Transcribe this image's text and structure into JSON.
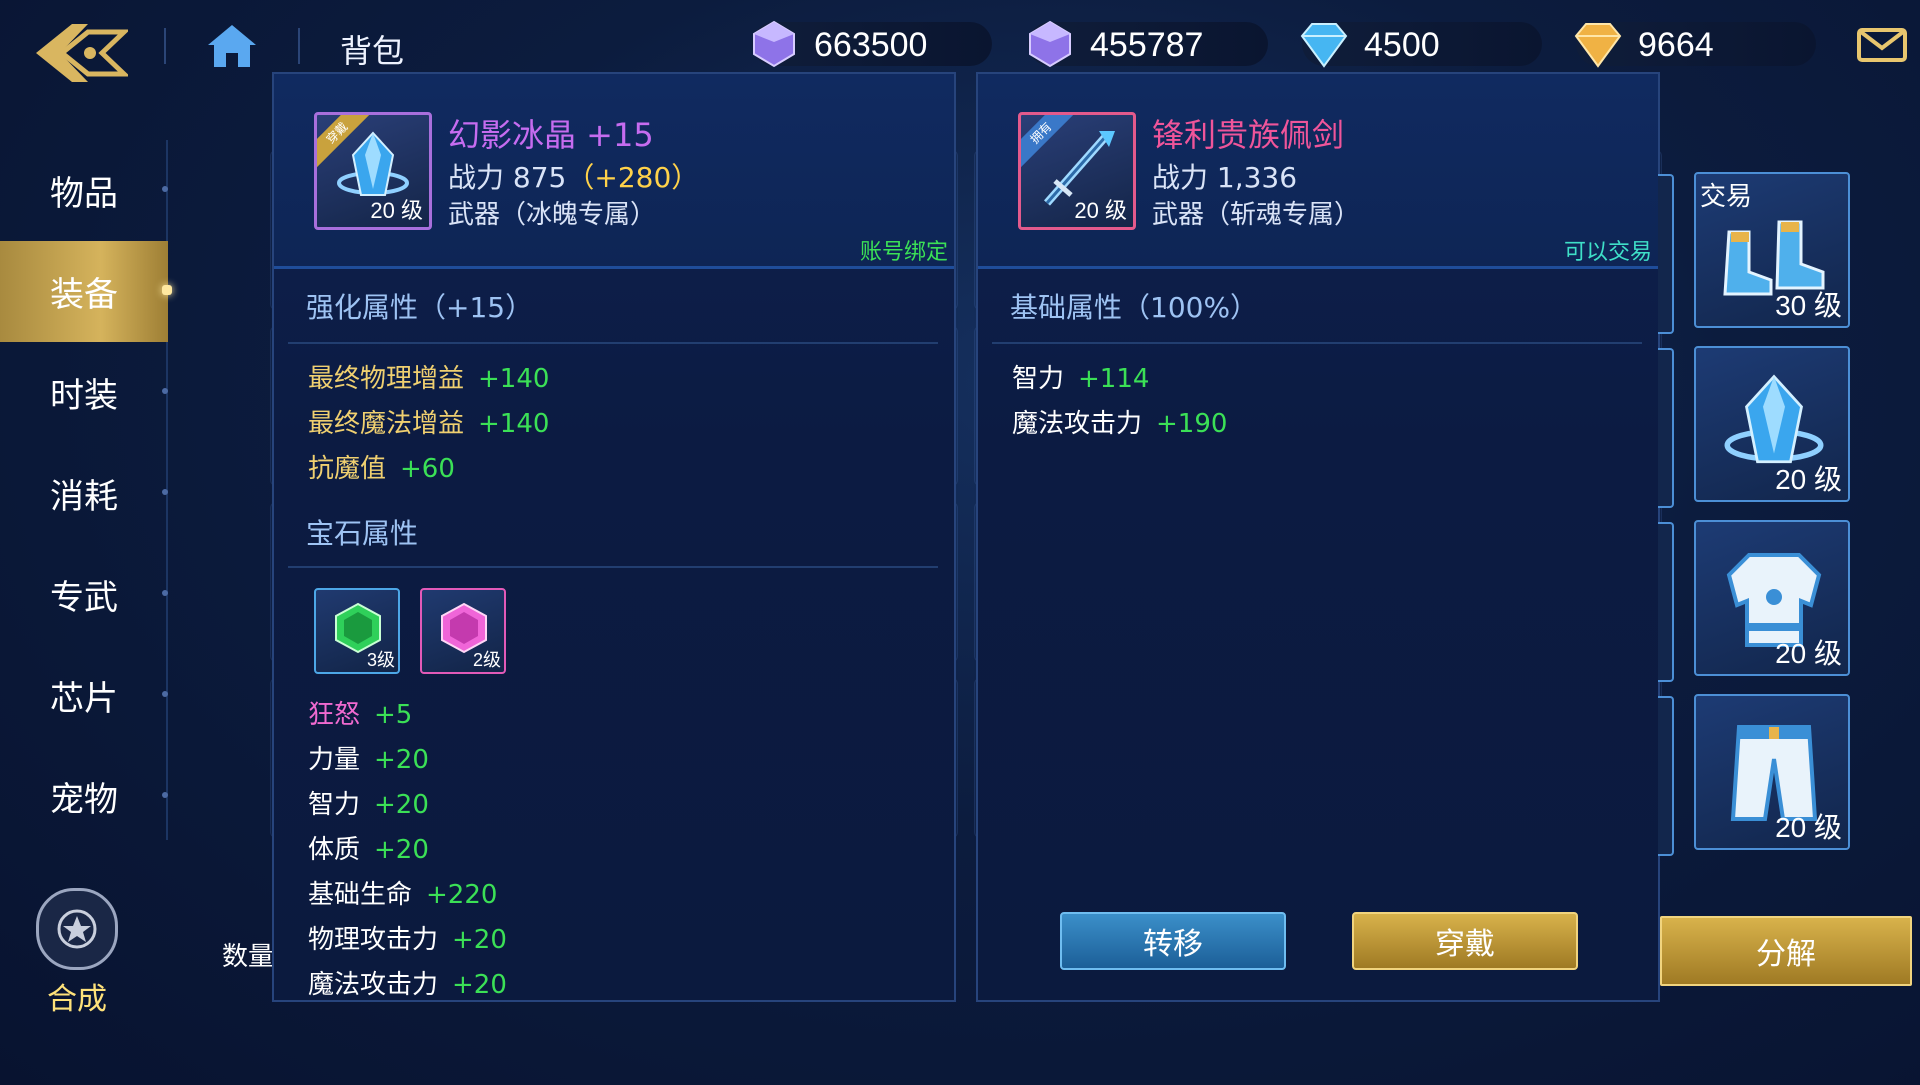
{
  "header": {
    "title": "背包",
    "currencies": [
      {
        "icon": "bound-purple-crystal-icon",
        "value": "663500"
      },
      {
        "icon": "purple-crystal-icon",
        "value": "455787"
      },
      {
        "icon": "blue-diamond-icon",
        "value": "4500"
      },
      {
        "icon": "gold-diamond-icon",
        "value": "9664"
      }
    ]
  },
  "sidebar": {
    "items": [
      {
        "label": "物品"
      },
      {
        "label": "装备"
      },
      {
        "label": "时装"
      },
      {
        "label": "消耗"
      },
      {
        "label": "专武"
      },
      {
        "label": "芯片"
      },
      {
        "label": "宠物"
      }
    ],
    "active_index": 1,
    "synth_label": "合成"
  },
  "quantity_label": "数量",
  "left_panel": {
    "badge": "穿戴",
    "item_level": "20 级",
    "name": "幻影冰晶 +15",
    "power_label": "战力 875",
    "power_bonus": "（+280）",
    "type": "武器（冰魄专属）",
    "bind_tag": "账号绑定",
    "enhance_title": "强化属性（+15）",
    "enhance_attrs": [
      {
        "name": "最终物理增益",
        "value": "+140"
      },
      {
        "name": "最终魔法增益",
        "value": "+140"
      },
      {
        "name": "抗魔值",
        "value": "+60"
      }
    ],
    "gem_title": "宝石属性",
    "gems": [
      {
        "icon": "green-gem-icon",
        "level": "3级"
      },
      {
        "icon": "pink-gem-icon",
        "level": "2级"
      }
    ],
    "gem_attrs": [
      {
        "name": "狂怒",
        "value": "+5",
        "color": "#f06ad0"
      },
      {
        "name": "力量",
        "value": "+20",
        "color": "#ffffff"
      },
      {
        "name": "智力",
        "value": "+20",
        "color": "#ffffff"
      },
      {
        "name": "体质",
        "value": "+20",
        "color": "#ffffff"
      },
      {
        "name": "基础生命",
        "value": "+220",
        "color": "#ffffff"
      },
      {
        "name": "物理攻击力",
        "value": "+20",
        "color": "#ffffff"
      },
      {
        "name": "魔法攻击力",
        "value": "+20",
        "color": "#ffffff"
      }
    ]
  },
  "right_panel": {
    "badge": "拥有",
    "item_level": "20 级",
    "name": "锋利贵族佩剑",
    "power_label": "战力 1,336",
    "type": "武器（斩魂专属）",
    "trade_tag": "可以交易",
    "base_title": "基础属性（100%）",
    "base_attrs": [
      {
        "name": "智力",
        "value": "+114"
      },
      {
        "name": "魔法攻击力",
        "value": "+190"
      }
    ],
    "transfer_button": "转移",
    "equip_button": "穿戴"
  },
  "right_slots": [
    {
      "trade_label": "交易",
      "level": "30 级",
      "icon": "boots-icon"
    },
    {
      "trade_label": "",
      "level": "20 级",
      "icon": "ice-crystal-icon"
    },
    {
      "trade_label": "",
      "level": "20 级",
      "icon": "armor-vest-icon"
    },
    {
      "trade_label": "",
      "level": "20 级",
      "icon": "pants-icon"
    }
  ],
  "decompose_button": "分解",
  "colors": {
    "accent_gold": "#d5b35c",
    "item_name_purple": "#c66cf0",
    "item_name_pink": "#f0559a",
    "bonus_yellow": "#ffd24a",
    "positive_green": "#3be056",
    "bind_green": "#3be056",
    "trade_cyan": "#3fe0c8"
  }
}
